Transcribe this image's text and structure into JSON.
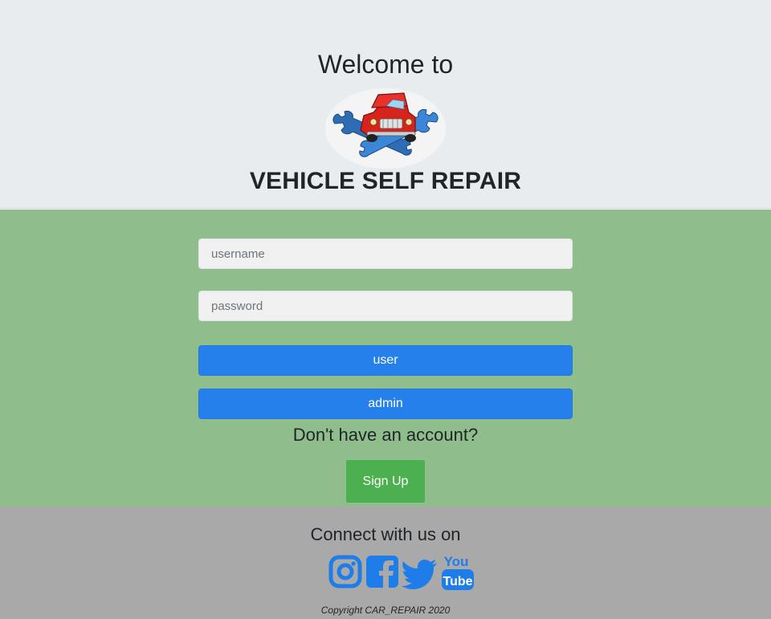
{
  "header": {
    "welcome": "Welcome to",
    "brand": "VEHICLE SELF REPAIR",
    "logo_icon": "car-repair-logo-icon"
  },
  "login": {
    "username_placeholder": "username",
    "password_placeholder": "password",
    "user_button": "user",
    "admin_button": "admin",
    "no_account_text": "Don't have an account?",
    "signup_button": "Sign Up"
  },
  "footer": {
    "connect_text": "Connect with us on",
    "social_icons": [
      "instagram-icon",
      "facebook-icon",
      "twitter-icon",
      "youtube-icon"
    ],
    "youtube_logo_top": "You",
    "youtube_logo_bottom": "Tube",
    "copyright": "Copyright CAR_REPAIR 2020"
  },
  "colors": {
    "header_bg": "#e9ecef",
    "login_bg": "#8fbe8c",
    "footer_bg": "#a9a9a9",
    "primary_button": "#2680eb",
    "signup_button": "#4caf50",
    "social_icon": "#1e7de9"
  }
}
